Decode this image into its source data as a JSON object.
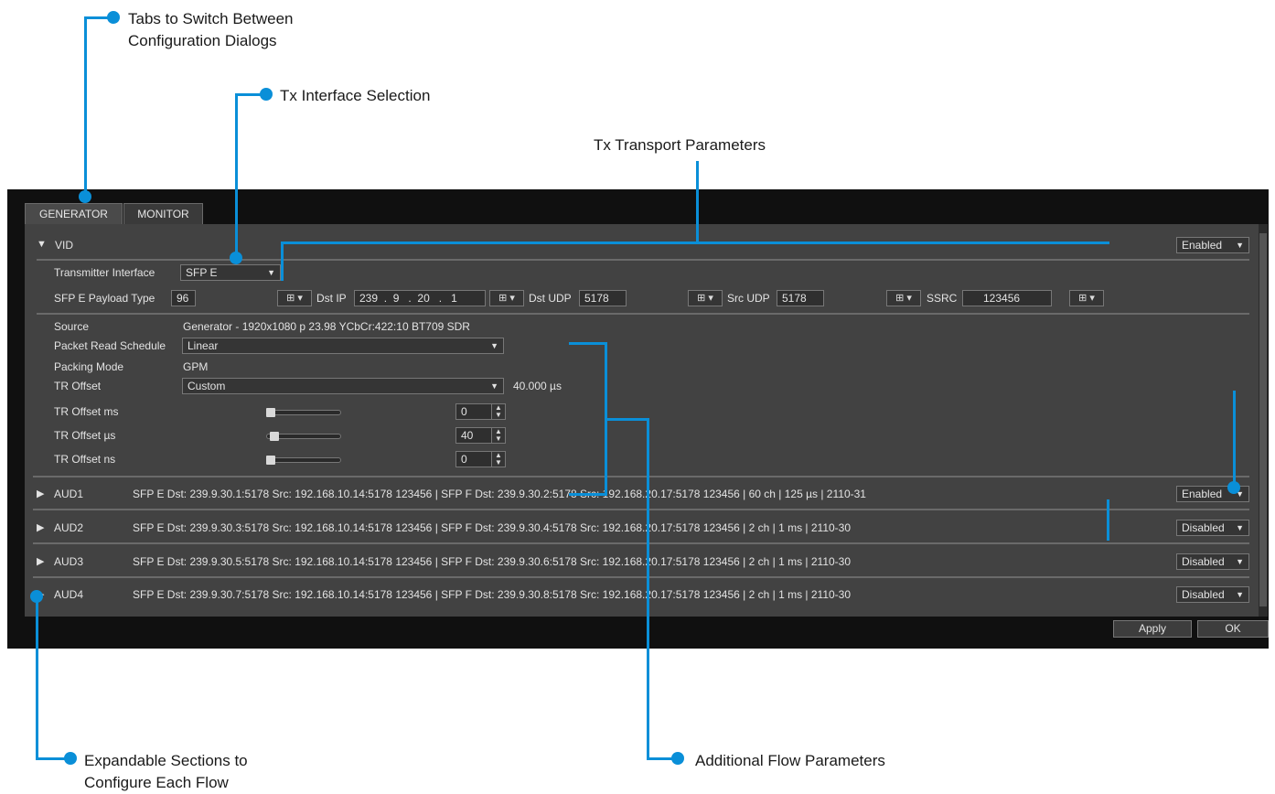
{
  "callouts": {
    "tabs": [
      "Tabs to Switch Between",
      "Configuration Dialogs"
    ],
    "tx_interface": "Tx Interface Selection",
    "tx_transport": "Tx Transport Parameters",
    "expandable": [
      "Expandable Sections to",
      "Configure Each Flow"
    ],
    "additional": "Additional Flow Parameters"
  },
  "tabs": [
    "GENERATOR",
    "MONITOR"
  ],
  "vid": {
    "label": "VID",
    "status": "Enabled",
    "transmitter_interface_label": "Transmitter Interface",
    "transmitter_interface_value": "SFP E",
    "payload_type_label": "SFP E Payload Type",
    "payload_type_value": "96",
    "dst_ip_label": "Dst IP",
    "dst_ip": [
      "239",
      "9",
      "20",
      "1"
    ],
    "dst_udp_label": "Dst UDP",
    "dst_udp_value": "5178",
    "src_udp_label": "Src UDP",
    "src_udp_value": "5178",
    "ssrc_label": "SSRC",
    "ssrc_value": "123456",
    "source_label": "Source",
    "source_value": "Generator - 1920x1080 p 23.98 YCbCr:422:10 BT709 SDR",
    "packet_read_label": "Packet Read Schedule",
    "packet_read_value": "Linear",
    "packing_mode_label": "Packing Mode",
    "packing_mode_value": "GPM",
    "tr_offset_label": "TR Offset",
    "tr_offset_value": "Custom",
    "tr_offset_display": "40.000 µs",
    "tr_ms_label": "TR Offset ms",
    "tr_ms_value": "0",
    "tr_us_label": "TR Offset µs",
    "tr_us_value": "40",
    "tr_ns_label": "TR Offset ns",
    "tr_ns_value": "0"
  },
  "audio": [
    {
      "label": "AUD1",
      "summary": "SFP E Dst: 239.9.30.1:5178 Src: 192.168.10.14:5178 123456 | SFP F Dst: 239.9.30.2:5178 Src: 192.168.20.17:5178 123456 | 60 ch | 125 µs | 2110-31",
      "status": "Enabled"
    },
    {
      "label": "AUD2",
      "summary": "SFP E Dst: 239.9.30.3:5178 Src: 192.168.10.14:5178 123456 | SFP F Dst: 239.9.30.4:5178 Src: 192.168.20.17:5178 123456 | 2 ch | 1 ms | 2110-30",
      "status": "Disabled"
    },
    {
      "label": "AUD3",
      "summary": "SFP E Dst: 239.9.30.5:5178 Src: 192.168.10.14:5178 123456 | SFP F Dst: 239.9.30.6:5178 Src: 192.168.20.17:5178 123456 | 2 ch | 1 ms | 2110-30",
      "status": "Disabled"
    },
    {
      "label": "AUD4",
      "summary": "SFP E Dst: 239.9.30.7:5178 Src: 192.168.10.14:5178 123456 | SFP F Dst: 239.9.30.8:5178 Src: 192.168.20.17:5178 123456 | 2 ch | 1 ms | 2110-30",
      "status": "Disabled"
    }
  ],
  "buttons": {
    "apply": "Apply",
    "ok": "OK"
  },
  "icons": {
    "grid": "grid-icon",
    "caret": "chevron-down-icon",
    "expand": "triangle-right-icon",
    "collapse": "triangle-down-icon"
  },
  "colors": {
    "accent": "#0a8fd8",
    "panel": "#424242",
    "window": "#101010"
  }
}
